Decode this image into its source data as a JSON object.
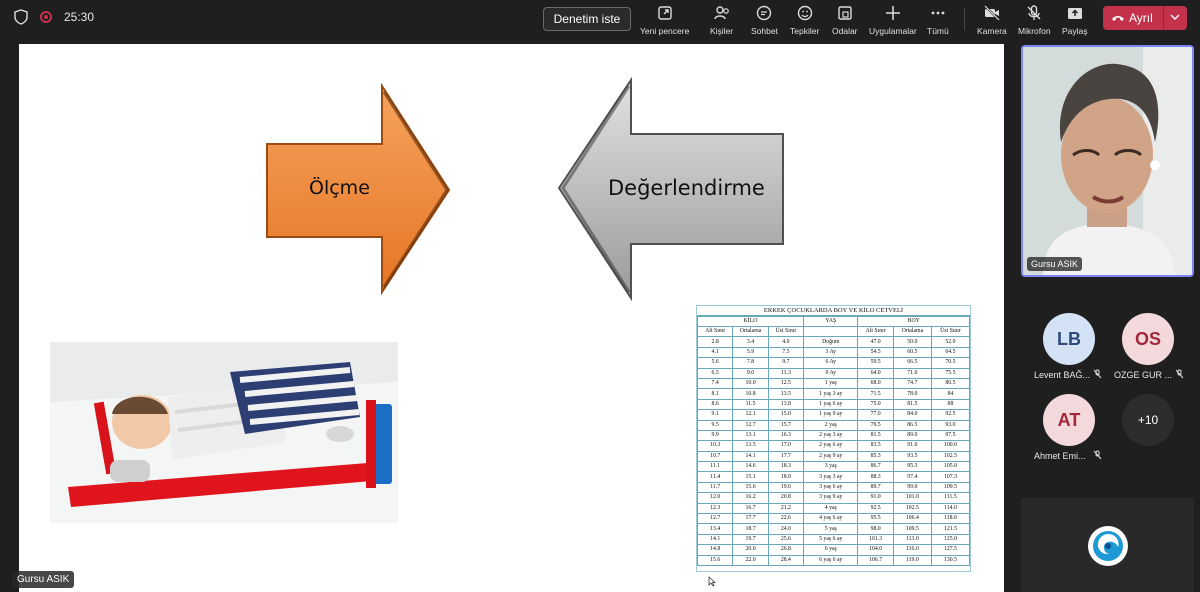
{
  "topbar": {
    "timer": "25:30",
    "control_label": "Denetim iste",
    "items": [
      {
        "label": "Yeni pencere",
        "icon": "new-window-icon"
      },
      {
        "label": "Kişiler",
        "icon": "people-icon"
      },
      {
        "label": "Sohbet",
        "icon": "chat-icon"
      },
      {
        "label": "Tepkiler",
        "icon": "reactions-icon"
      },
      {
        "label": "Odalar",
        "icon": "rooms-icon"
      },
      {
        "label": "Uygulamalar",
        "icon": "apps-icon"
      },
      {
        "label": "Tümü",
        "icon": "more-icon"
      },
      {
        "label": "Kamera",
        "icon": "camera-off-icon"
      },
      {
        "label": "Mikrofon",
        "icon": "mic-off-icon"
      },
      {
        "label": "Paylaş",
        "icon": "share-icon"
      }
    ],
    "leave_label": "Ayrıl"
  },
  "slide": {
    "left_arrow_label": "Ölçme",
    "right_arrow_label": "Değerlendirme",
    "presenter_name": "Gursu ASIK",
    "table": {
      "title": "ERKEK ÇOCUKLARDA BOY VE KİLO CETVELİ",
      "group_kilo": "KİLO",
      "group_yas": "YAŞ",
      "group_boy": "BOY",
      "headers": [
        "Alt Sınır",
        "Ortalama",
        "Üst Sınır",
        "",
        "Alt Sınır",
        "Ortalama",
        "Üst Sınır"
      ],
      "rows": [
        [
          "2.8",
          "3.4",
          "4.0",
          "Doğum",
          "47.0",
          "50.0",
          "52.0"
        ],
        [
          "4.1",
          "5.9",
          "7.5",
          "3 Ay",
          "54.5",
          "60.5",
          "64.5"
        ],
        [
          "5.6",
          "7.8",
          "9.7",
          "6 Ay",
          "59.5",
          "66.5",
          "70.5"
        ],
        [
          "6.5",
          "9.0",
          "11.3",
          "9 Ay",
          "64.0",
          "71.0",
          "75.5"
        ],
        [
          "7.4",
          "10.0",
          "12.5",
          "1 yaş",
          "68.0",
          "74.7",
          "80.5"
        ],
        [
          "8.1",
          "10.8",
          "13.5",
          "1 yaş 3 ay",
          "71.5",
          "78.0",
          "84"
        ],
        [
          "8.6",
          "11.5",
          "13.8",
          "1 yaş 6 ay",
          "75.0",
          "81.5",
          "88"
        ],
        [
          "9.1",
          "12.1",
          "15.0",
          "1 yaş 9 ay",
          "77.0",
          "84.0",
          "92.5"
        ],
        [
          "9.5",
          "12.7",
          "15.7",
          "2 yaş",
          "79.5",
          "86.5",
          "93.0"
        ],
        [
          "9.9",
          "13.1",
          "16.3",
          "2 yaş 3 ay",
          "81.5",
          "89.0",
          "97.5"
        ],
        [
          "10.3",
          "13.5",
          "17.0",
          "2 yaş 6 ay",
          "83.5",
          "91.0",
          "100.0"
        ],
        [
          "10.7",
          "14.1",
          "17.7",
          "2 yaş 9 ay",
          "85.3",
          "93.5",
          "102.5"
        ],
        [
          "11.1",
          "14.6",
          "18.3",
          "3 yaş",
          "86.7",
          "95.3",
          "105.0"
        ],
        [
          "11.4",
          "15.1",
          "18.9",
          "3 yaş 3 ay",
          "88.3",
          "97.4",
          "107.3"
        ],
        [
          "11.7",
          "15.6",
          "19.6",
          "3 yaş 6 ay",
          "89.7",
          "99.0",
          "109.5"
        ],
        [
          "12.0",
          "16.2",
          "20.8",
          "3 yaş 9 ay",
          "91.0",
          "101.0",
          "111.5"
        ],
        [
          "12.3",
          "16.7",
          "21.2",
          "4 yaş",
          "92.5",
          "102.5",
          "114.0"
        ],
        [
          "12.7",
          "17.7",
          "22.6",
          "4 yaş 6 ay",
          "95.5",
          "106.4",
          "118.0"
        ],
        [
          "13.4",
          "18.7",
          "24.0",
          "5 yaş",
          "98.0",
          "109.5",
          "121.5"
        ],
        [
          "14.1",
          "19.7",
          "25.6",
          "5 yaş 6 ay",
          "101.3",
          "113.0",
          "125.0"
        ],
        [
          "14.8",
          "20.0",
          "26.8",
          "6 yaş",
          "104.0",
          "116.0",
          "127.5"
        ],
        [
          "15.6",
          "22.0",
          "28.4",
          "6 yaş 6 ay",
          "106.7",
          "119.0",
          "130.5"
        ]
      ]
    }
  },
  "participants": {
    "self_name": "Gursu ASIK",
    "people": [
      {
        "initials": "LB",
        "name": "Levent BAĞ..."
      },
      {
        "initials": "OS",
        "name": "OZGE GUR ..."
      },
      {
        "initials": "AT",
        "name": "Ahmet Emi..."
      }
    ],
    "more_count": "+10"
  },
  "colors": {
    "accent": "#c4314b",
    "self_border": "#7f85f5",
    "arrow_orange": "#f28c3c",
    "arrow_gray": "#a8a8a8",
    "avatar_blue_bg": "#d3e3f5",
    "avatar_pink_bg": "#f4d9dc"
  }
}
